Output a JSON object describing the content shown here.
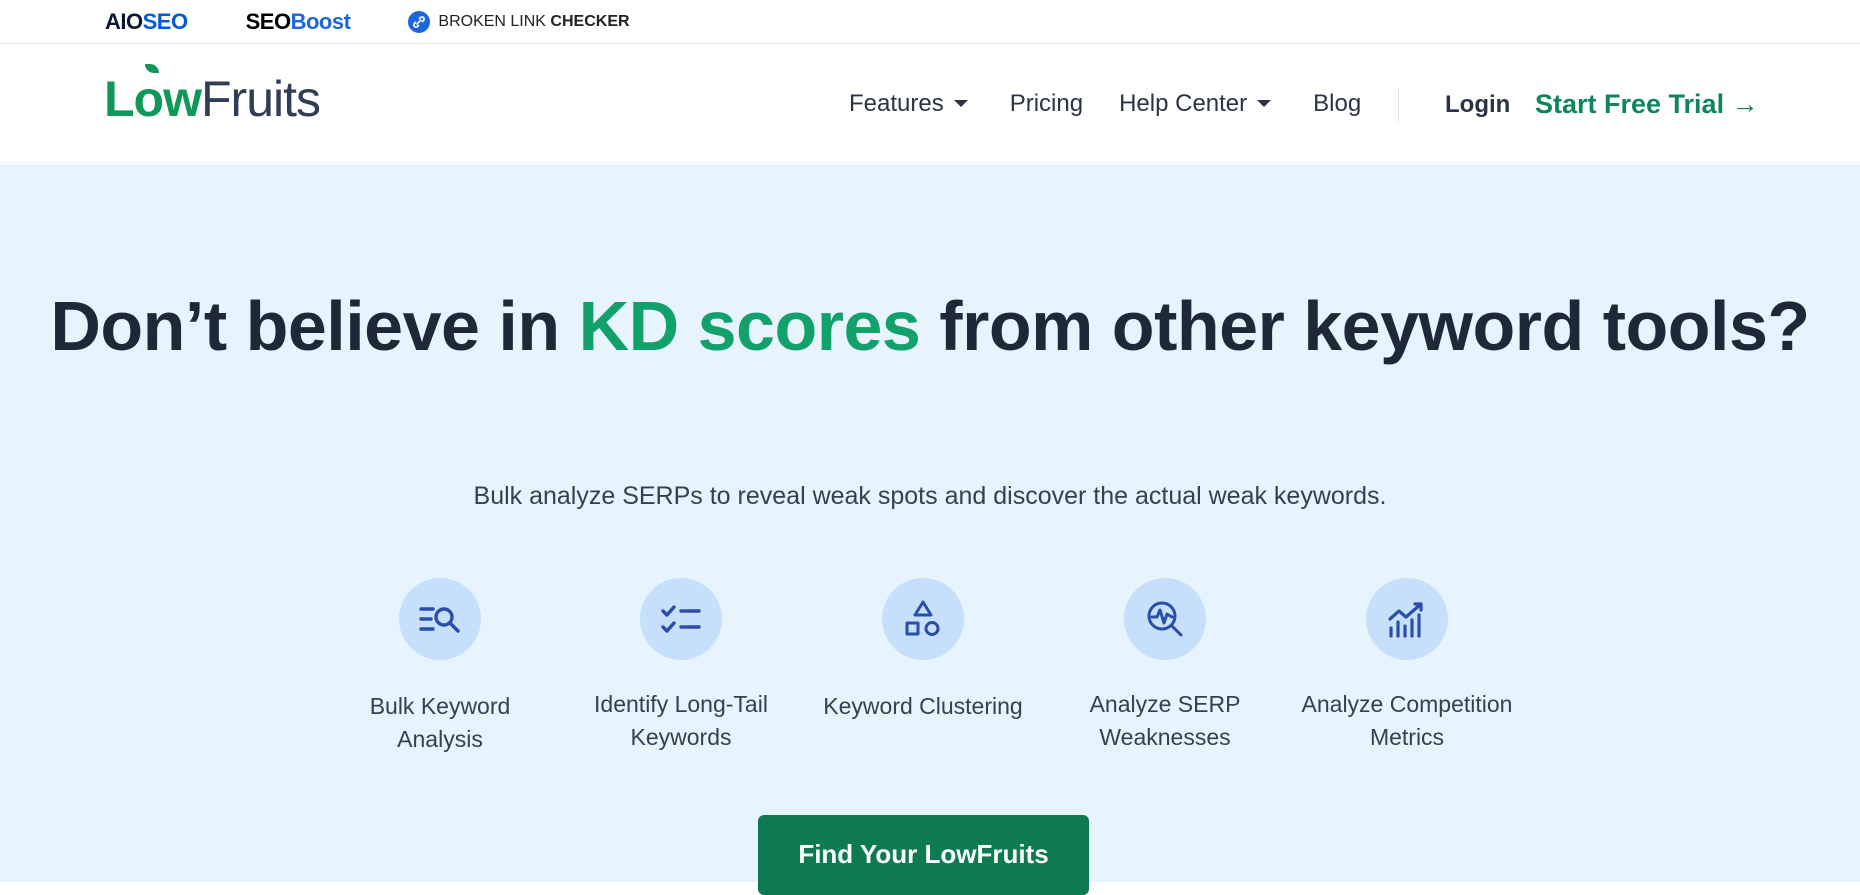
{
  "topbar": {
    "brands": [
      {
        "part1": "AIO",
        "part2": "SEO"
      },
      {
        "part1": "SEO",
        "part2": "Boost"
      },
      {
        "part1": "BROKEN LINK ",
        "part2": "CHECKER"
      }
    ]
  },
  "navbar": {
    "logo": {
      "part1": "L",
      "part2": "w",
      "part3": "Fruits"
    },
    "items": [
      {
        "label": "Features",
        "has_dropdown": true
      },
      {
        "label": "Pricing",
        "has_dropdown": false
      },
      {
        "label": "Help Center",
        "has_dropdown": true
      },
      {
        "label": "Blog",
        "has_dropdown": false
      }
    ],
    "login": "Login",
    "trial": "Start Free Trial →"
  },
  "hero": {
    "title_part1": "Don’t believe in ",
    "title_highlight": "KD scores",
    "title_part2": " from other keyword tools?",
    "subtitle": "Bulk analyze SERPs to reveal weak spots and discover the actual weak keywords.",
    "features": [
      {
        "label": "Bulk Keyword Analysis",
        "icon": "search-list-icon"
      },
      {
        "label": "Identify Long-Tail Keywords",
        "icon": "checklist-icon"
      },
      {
        "label": "Keyword Clustering",
        "icon": "shapes-icon"
      },
      {
        "label": "Analyze SERP Weaknesses",
        "icon": "pulse-search-icon"
      },
      {
        "label": "Analyze Competition Metrics",
        "icon": "bar-chart-icon"
      }
    ],
    "cta": "Find Your LowFruits"
  },
  "colors": {
    "accent_green": "#12a06b",
    "cta_green": "#0d7a51",
    "hero_bg": "#e7f3fd",
    "icon_blue": "#2b4ea8"
  }
}
